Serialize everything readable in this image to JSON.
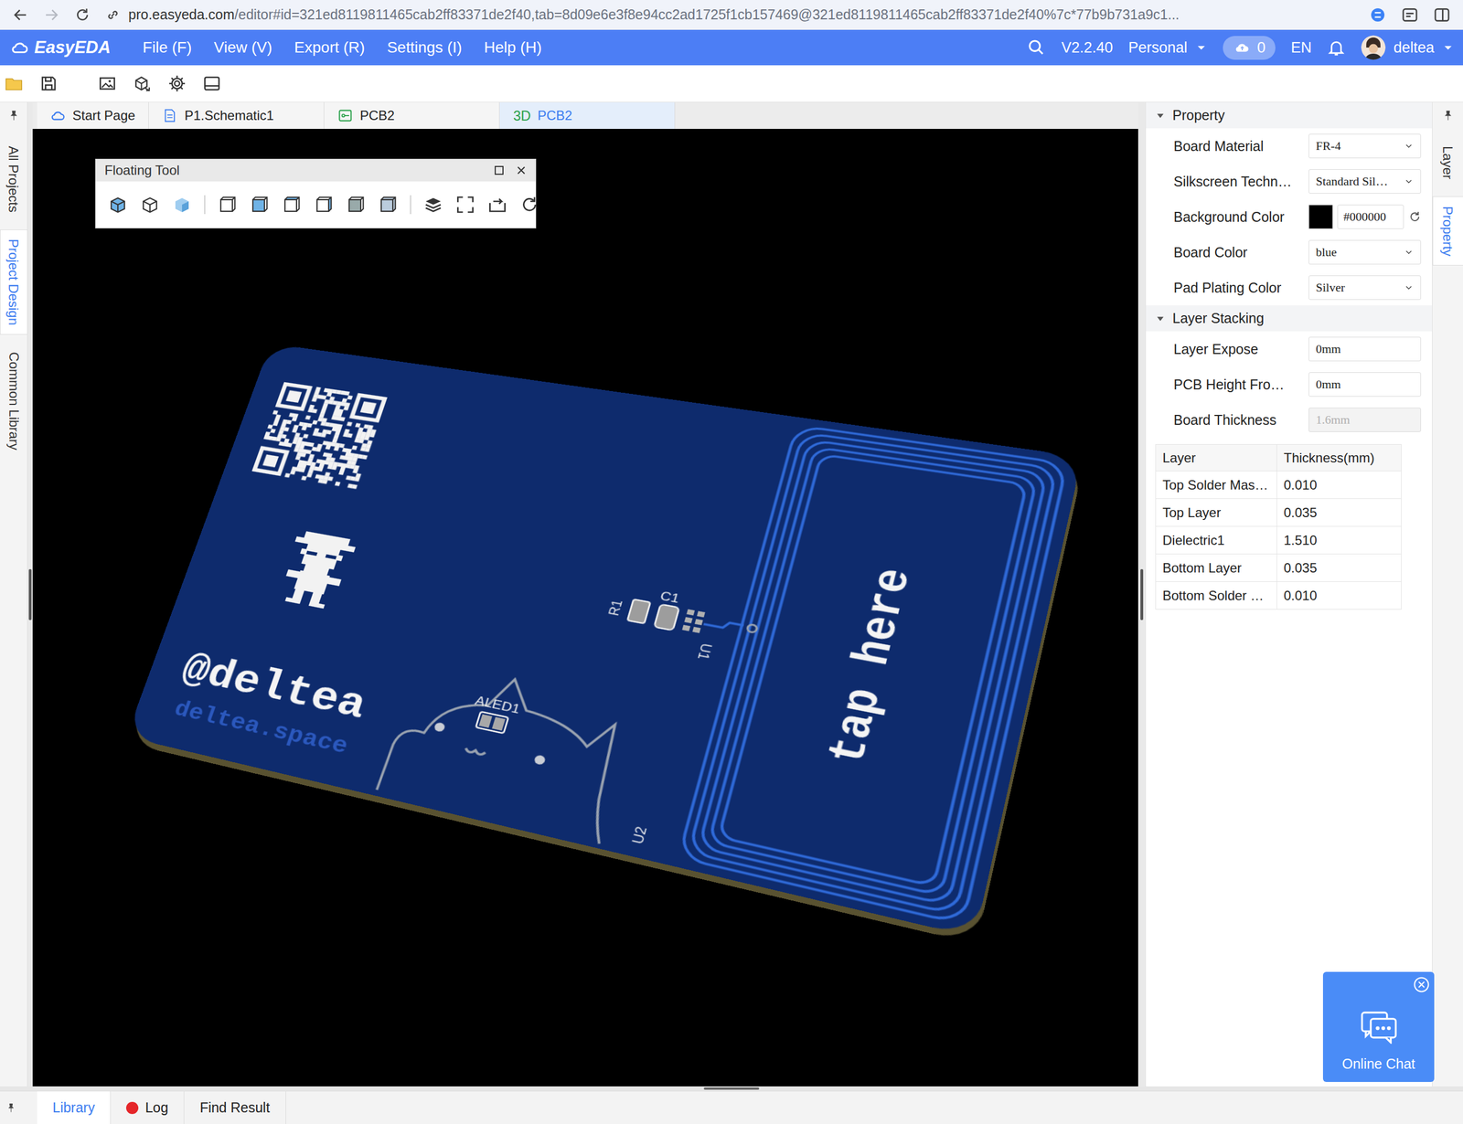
{
  "browser": {
    "url_host": "pro.easyeda.com",
    "url_path": "/editor#id=321ed8119811465cab2ff83371de2f40,tab=8d09e6e3f8e94cc2ad1725f1cb157469@321ed8119811465cab2ff83371de2f40%7c*77b9b731a9c1..."
  },
  "app": {
    "logo": "EasyEDA",
    "menus": [
      "File (F)",
      "View (V)",
      "Export (R)",
      "Settings (I)",
      "Help (H)"
    ],
    "version": "V2.2.40",
    "workspace": "Personal",
    "cloud_count": "0",
    "language": "EN",
    "user": "deltea"
  },
  "doc_tabs": [
    {
      "label": "Start Page",
      "selected": false,
      "kind": "home"
    },
    {
      "label": "P1.Schematic1",
      "selected": false,
      "kind": "schematic"
    },
    {
      "label": "PCB2",
      "selected": false,
      "kind": "pcb"
    },
    {
      "prefix": "3D",
      "label": "PCB2",
      "selected": true,
      "kind": "view3d"
    }
  ],
  "left_sidebar": [
    {
      "label": "All Projects",
      "selected": false
    },
    {
      "label": "Project Design",
      "selected": true
    },
    {
      "label": "Common Library",
      "selected": false
    }
  ],
  "right_sidebar": [
    {
      "label": "Layer",
      "selected": false
    },
    {
      "label": "Property",
      "selected": true
    }
  ],
  "floating_tool": {
    "title": "Floating Tool"
  },
  "board": {
    "handle": "@deltea",
    "site": "deltea.space",
    "cta": "tap here",
    "silk": [
      "ALED1",
      "R1",
      "C1",
      "U1",
      "U2"
    ]
  },
  "property": {
    "header": "Property",
    "expanded": true,
    "rows": [
      {
        "label": "Board Material",
        "value": "FR-4",
        "kind": "select"
      },
      {
        "label": "Silkscreen Techn…",
        "value": "Standard Sil…",
        "kind": "select"
      },
      {
        "label": "Background Color",
        "value": "#000000",
        "kind": "color",
        "swatch": "#000000"
      },
      {
        "label": "Board Color",
        "value": "blue",
        "kind": "select"
      },
      {
        "label": "Pad Plating Color",
        "value": "Silver",
        "kind": "select"
      }
    ]
  },
  "layer_stacking": {
    "header": "Layer Stacking",
    "expanded": true,
    "rows": [
      {
        "label": "Layer Expose",
        "value": "0mm",
        "kind": "input",
        "disabled": false
      },
      {
        "label": "PCB Height Fro…",
        "value": "0mm",
        "kind": "input",
        "disabled": false
      },
      {
        "label": "Board Thickness",
        "value": "1.6mm",
        "kind": "input",
        "disabled": true
      }
    ],
    "table": {
      "columns": [
        "Layer",
        "Thickness(mm)"
      ],
      "rows": [
        [
          "Top Solder Mas…",
          "0.010"
        ],
        [
          "Top Layer",
          "0.035"
        ],
        [
          "Dielectric1",
          "1.510"
        ],
        [
          "Bottom Layer",
          "0.035"
        ],
        [
          "Bottom Solder …",
          "0.010"
        ]
      ]
    }
  },
  "bottom_tabs": [
    {
      "label": "Library",
      "selected": true,
      "dot": false
    },
    {
      "label": "Log",
      "selected": false,
      "dot": true
    },
    {
      "label": "Find Result",
      "selected": false,
      "dot": false
    }
  ],
  "chat": {
    "label": "Online Chat"
  }
}
